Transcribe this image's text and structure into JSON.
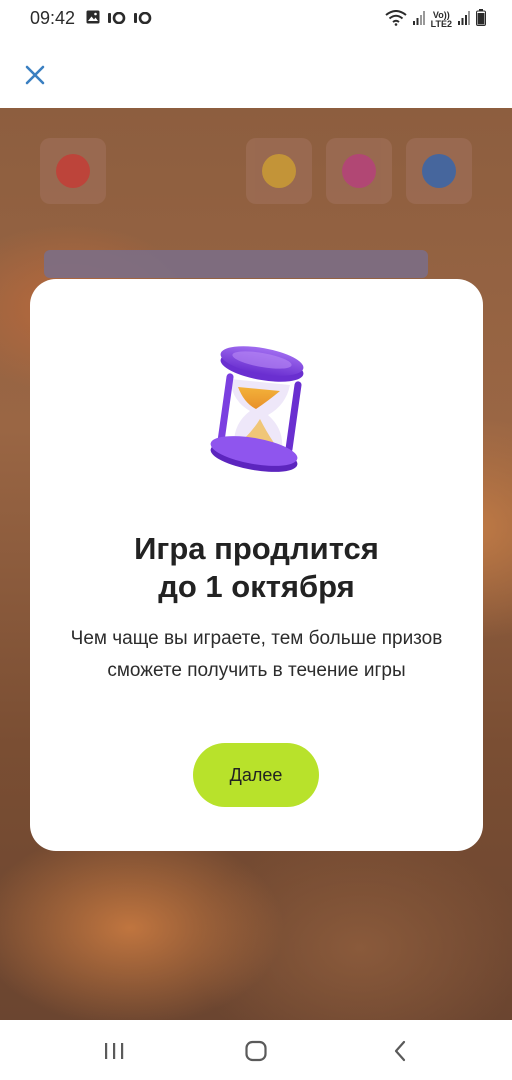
{
  "status_bar": {
    "time": "09:42",
    "left_icons": [
      "image-icon",
      "notification-app-icon",
      "notification-app-icon"
    ],
    "right_icons": [
      "wifi-icon",
      "signal-icon",
      "signal-icon",
      "battery-icon"
    ],
    "volte_label": "Vo))",
    "lte_label": "LTE2"
  },
  "app_bar": {
    "close_icon": "close-icon",
    "accent": "#3a7fc1"
  },
  "dialog": {
    "illustration": "hourglass-icon",
    "title": "Игра продлится\nдо 1 октября",
    "body": "Чем чаще вы играете, тем больше призов сможете получить в течение игры",
    "next_button_label": "Далее",
    "button_color": "#b8e22b"
  },
  "nav_bar": {
    "items": [
      "recent-apps-icon",
      "home-icon",
      "back-icon"
    ]
  }
}
